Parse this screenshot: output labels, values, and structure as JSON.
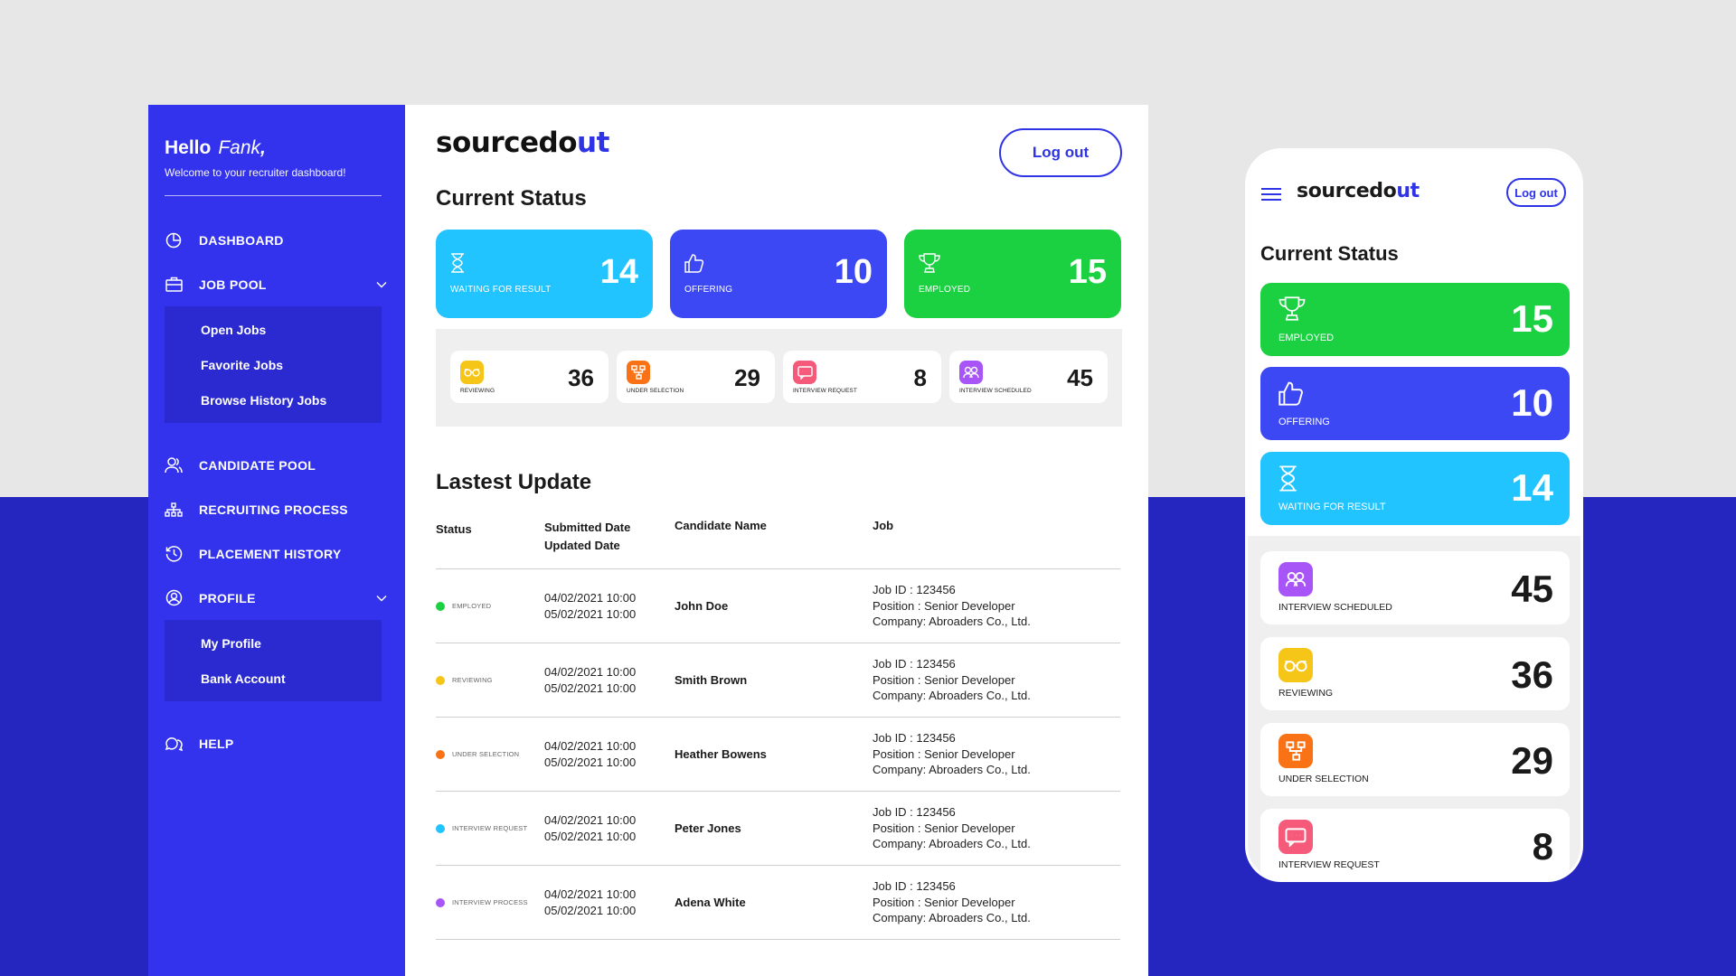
{
  "colors": {
    "primary": "#3333ee",
    "accent": "#2f33e6",
    "waiting": "#22c4ff",
    "offering": "#3d48f5",
    "employed": "#1bd142",
    "reviewing": "#f5c518",
    "under_selection": "#f97316",
    "interview_request": "#f55a7a",
    "interview_scheduled": "#a855f7"
  },
  "sidebar": {
    "hello": "Hello",
    "name": "Fank",
    "comma": ",",
    "welcome": "Welcome to your recruiter dashboard!",
    "items": [
      {
        "label": "DASHBOARD",
        "icon": "pie-chart-icon"
      },
      {
        "label": "JOB POOL",
        "icon": "briefcase-icon"
      },
      {
        "label": "CANDIDATE POOL",
        "icon": "users-icon"
      },
      {
        "label": "RECRUITING PROCESS",
        "icon": "hierarchy-icon"
      },
      {
        "label": "PLACEMENT HISTORY",
        "icon": "history-icon"
      },
      {
        "label": "PROFILE",
        "icon": "user-circle-icon"
      },
      {
        "label": "HELP",
        "icon": "chat-bubbles-icon"
      }
    ],
    "job_pool_sub": [
      "Open Jobs",
      "Favorite Jobs",
      "Browse History Jobs"
    ],
    "profile_sub": [
      "My Profile",
      "Bank Account"
    ]
  },
  "header": {
    "logo_main": "sourcedo",
    "logo_accent": "ut",
    "logout": "Log out"
  },
  "current_status": {
    "title": "Current Status",
    "cards": [
      {
        "label": "WAITING FOR RESULT",
        "value": "14",
        "icon": "hourglass-icon"
      },
      {
        "label": "OFFERING",
        "value": "10",
        "icon": "thumbs-up-icon"
      },
      {
        "label": "EMPLOYED",
        "value": "15",
        "icon": "trophy-icon"
      }
    ],
    "mini": [
      {
        "label": "REVIEWING",
        "value": "36",
        "icon": "glasses-icon"
      },
      {
        "label": "UNDER SELECTION",
        "value": "29",
        "icon": "flow-icon"
      },
      {
        "label": "INTERVIEW REQUEST",
        "value": "8",
        "icon": "message-icon"
      },
      {
        "label": "INTERVIEW SCHEDULED",
        "value": "45",
        "icon": "people-icon"
      }
    ]
  },
  "latest_update": {
    "title": "Lastest Update",
    "headers": {
      "status": "Status",
      "submitted": "Submitted Date",
      "updated": "Updated Date",
      "candidate": "Candidate Name",
      "job": "Job"
    },
    "rows": [
      {
        "status": "EMPLOYED",
        "submitted": "04/02/2021  10:00",
        "updated": "05/02/2021  10:00",
        "name": "John Doe",
        "job_id": "Job ID : 123456",
        "position": "Position : Senior Developer",
        "company": "Company: Abroaders Co., Ltd."
      },
      {
        "status": "REVIEWING",
        "submitted": "04/02/2021  10:00",
        "updated": "05/02/2021  10:00",
        "name": "Smith Brown",
        "job_id": "Job ID : 123456",
        "position": "Position : Senior Developer",
        "company": "Company: Abroaders Co., Ltd."
      },
      {
        "status": "UNDER SELECTION",
        "submitted": "04/02/2021  10:00",
        "updated": "05/02/2021  10:00",
        "name": "Heather Bowens",
        "job_id": "Job ID : 123456",
        "position": "Position : Senior Developer",
        "company": "Company: Abroaders Co., Ltd."
      },
      {
        "status": "INTERVIEW REQUEST",
        "submitted": "04/02/2021  10:00",
        "updated": "05/02/2021  10:00",
        "name": "Peter Jones",
        "job_id": "Job ID : 123456",
        "position": "Position : Senior Developer",
        "company": "Company: Abroaders Co., Ltd."
      },
      {
        "status": "INTERVIEW PROCESS",
        "submitted": "04/02/2021  10:00",
        "updated": "05/02/2021  10:00",
        "name": "Adena White",
        "job_id": "Job ID : 123456",
        "position": "Position : Senior Developer",
        "company": "Company: Abroaders Co., Ltd."
      }
    ]
  },
  "mobile": {
    "logo_main": "sourcedo",
    "logo_accent": "ut",
    "logout": "Log out",
    "title": "Current Status",
    "cards": [
      {
        "label": "EMPLOYED",
        "value": "15"
      },
      {
        "label": "OFFERING",
        "value": "10"
      },
      {
        "label": "WAITING FOR RESULT",
        "value": "14"
      }
    ],
    "items": [
      {
        "label": "INTERVIEW SCHEDULED",
        "value": "45"
      },
      {
        "label": "REVIEWING",
        "value": "36"
      },
      {
        "label": "UNDER SELECTION",
        "value": "29"
      },
      {
        "label": "INTERVIEW REQUEST",
        "value": "8"
      }
    ]
  }
}
